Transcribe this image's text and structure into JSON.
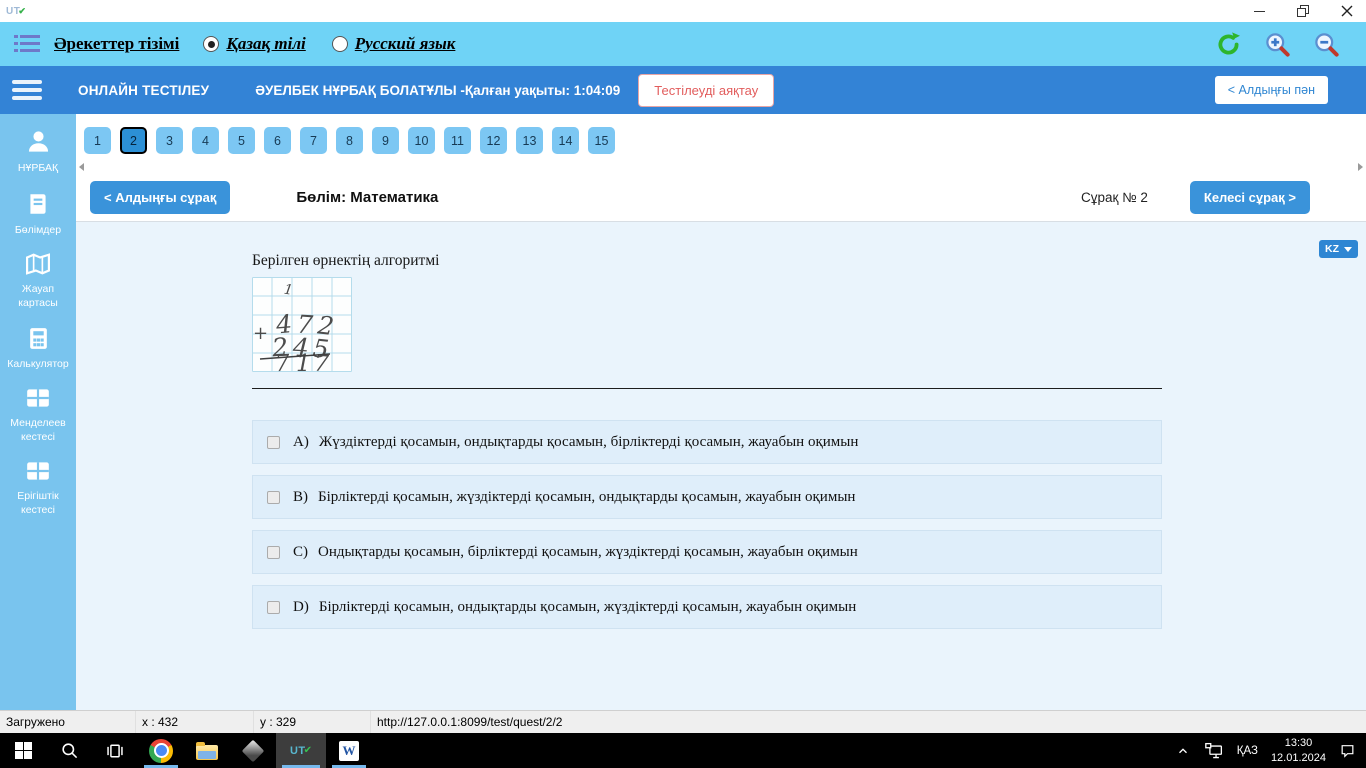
{
  "titlebar": {
    "logo_text": "UT"
  },
  "menubar": {
    "list_label": "Әрекеттер тізімі",
    "lang_options": [
      {
        "label": "Қазақ тілі",
        "selected": true
      },
      {
        "label": "Русский язык",
        "selected": false
      }
    ]
  },
  "header": {
    "app_title": "ОНЛАЙН ТЕСТІЛЕУ",
    "user_timer": "ӘУЕЛБЕК НҰРБАҚ БОЛАТҰЛЫ -Қалған уақыты: 1:04:09",
    "finish_label": "Тестілеуді аяқтау",
    "prev_subject_label": "< Алдыңғы пән"
  },
  "sidebar": {
    "items": [
      {
        "label": "НҰРБАҚ",
        "icon": "user-icon"
      },
      {
        "label": "Бөлімдер",
        "icon": "book-icon"
      },
      {
        "label": "Жауап картасы",
        "icon": "map-icon"
      },
      {
        "label": "Калькулятор",
        "icon": "calculator-icon"
      },
      {
        "label": "Менделеев кестесі",
        "icon": "table-icon"
      },
      {
        "label": "Ерігіштік кестесі",
        "icon": "table-icon"
      }
    ]
  },
  "question_nav": {
    "numbers": [
      "1",
      "2",
      "3",
      "4",
      "5",
      "6",
      "7",
      "8",
      "9",
      "10",
      "11",
      "12",
      "13",
      "14",
      "15"
    ],
    "active": "2"
  },
  "question_bar": {
    "prev_label": "< Алдыңғы сұрақ",
    "section": "Бөлім: Математика",
    "number_label": "Сұрақ № 2",
    "next_label": "Келесі сұрақ >"
  },
  "question": {
    "lang_code": "KZ",
    "prompt": "Берілген өрнектің алгоритмі",
    "worksheet": {
      "carry": "1",
      "operator": "+",
      "row1": [
        "4",
        "7",
        "2"
      ],
      "row2": [
        "2",
        "4",
        "5"
      ],
      "result": [
        "7",
        "1",
        "7"
      ]
    },
    "options": [
      {
        "letter": "A)",
        "text": "Жүздіктерді қосамын, ондықтарды қосамын, бірліктерді қосамын, жауабын оқимын"
      },
      {
        "letter": "B)",
        "text": "Бірліктерді қосамын, жүздіктерді қосамын, ондықтарды қосамын, жауабын оқимын"
      },
      {
        "letter": "C)",
        "text": "Ондықтарды қосамын, бірліктерді қосамын, жүздіктерді қосамын, жауабын оқимын"
      },
      {
        "letter": "D)",
        "text": "Бірліктерді қосамын, ондықтарды қосамын, жүздіктерді қосамын, жауабын оқимын"
      }
    ]
  },
  "statusbar": {
    "state": "Загружено",
    "x_coord": "x : 432",
    "y_coord": "y : 329",
    "url": "http://127.0.0.1:8099/test/quest/2/2"
  },
  "taskbar": {
    "uto_label": "UT",
    "word_label": "W"
  },
  "tray": {
    "language": "ҚАЗ",
    "time": "13:30",
    "date": "12.01.2024"
  },
  "colors": {
    "header_blue": "#3383d6",
    "menubar_blue": "#6fd3f6",
    "sidebar_blue": "#79c4ee",
    "tab_blue": "#7cc7f3",
    "active_tab_blue": "#2c90d6",
    "button_blue": "#3a93da",
    "option_bg": "#dfeefa",
    "content_bg": "#eaf4fc",
    "finish_red": "#e25d5d",
    "taskbar_black": "#000000"
  }
}
